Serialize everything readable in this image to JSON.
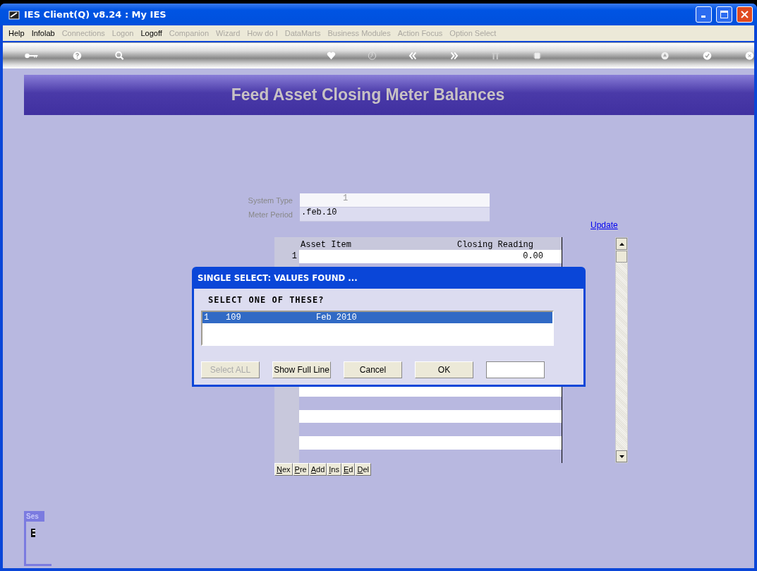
{
  "window": {
    "title": "IES Client(Q) v8.24 : My IES"
  },
  "menu": [
    {
      "label": "Help",
      "disabled": false
    },
    {
      "label": "Infolab",
      "disabled": false
    },
    {
      "label": "Connections",
      "disabled": true
    },
    {
      "label": "Logon",
      "disabled": true
    },
    {
      "label": "Logoff",
      "disabled": false
    },
    {
      "label": "Companion",
      "disabled": true
    },
    {
      "label": "Wizard",
      "disabled": true
    },
    {
      "label": "How do I",
      "disabled": true
    },
    {
      "label": "DataMarts",
      "disabled": true
    },
    {
      "label": "Business Modules",
      "disabled": true
    },
    {
      "label": "Action Focus",
      "disabled": true
    },
    {
      "label": "Option Select",
      "disabled": true
    }
  ],
  "page_title": "Feed Asset Closing Meter Balances",
  "form": [
    {
      "label": "System Type",
      "value": "1",
      "kind": "center"
    },
    {
      "label": "Meter Period",
      "value": ".feb.10",
      "kind": "left"
    }
  ],
  "update_link": "Update",
  "grid": {
    "columns": [
      "Asset Item",
      "Closing Reading"
    ],
    "rows": [
      {
        "number": "1",
        "asset_item": "",
        "closing_reading": "0.00"
      }
    ]
  },
  "grid_buttons": [
    "Nex",
    "Pre",
    "Add",
    "Ins",
    "Ed",
    "Del"
  ],
  "dialog": {
    "title": "SINGLE SELECT: VALUES FOUND ...",
    "prompt": "SELECT ONE OF THESE?",
    "items": [
      {
        "columns": [
          "1",
          "109",
          "Feb 2010"
        ],
        "selected": true
      }
    ],
    "buttons": [
      {
        "label": "Select ALL",
        "disabled": true
      },
      {
        "label": "Show Full Line",
        "disabled": false
      },
      {
        "label": "Cancel",
        "disabled": false
      },
      {
        "label": "OK",
        "disabled": false
      }
    ]
  },
  "side_tab": {
    "label": "Ses"
  }
}
